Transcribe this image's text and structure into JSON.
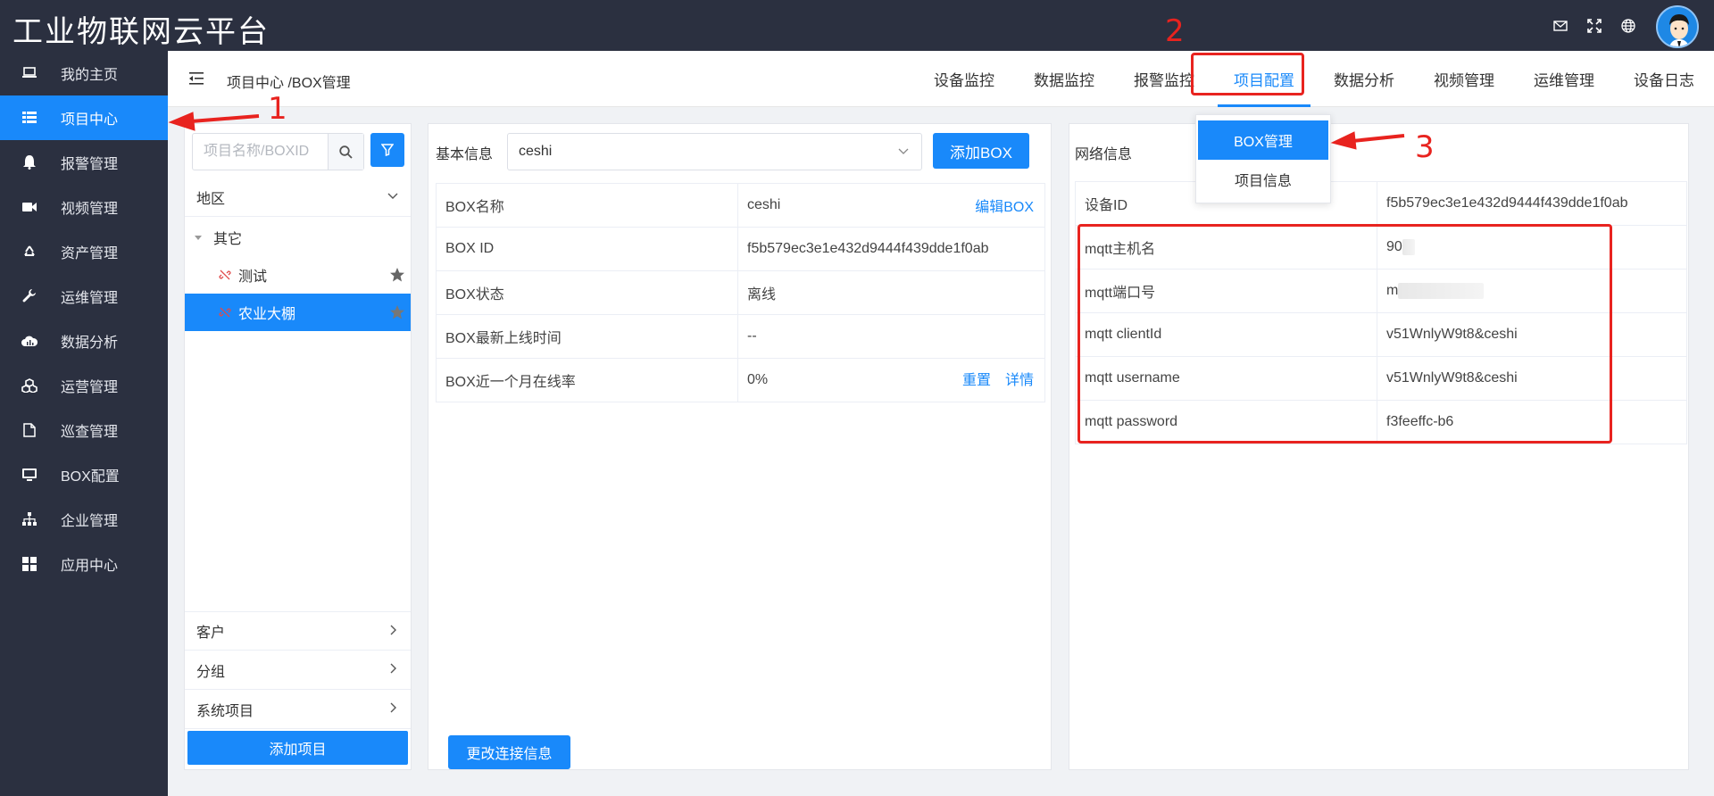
{
  "app": {
    "title": "工业物联网云平台"
  },
  "top_icons": [
    "mail-icon",
    "fullscreen-icon",
    "globe-icon"
  ],
  "sidebar": {
    "items": [
      {
        "label": "我的主页",
        "icon": "laptop-icon",
        "active": false
      },
      {
        "label": "项目中心",
        "icon": "list-icon",
        "active": true
      },
      {
        "label": "报警管理",
        "icon": "bell-icon",
        "active": false
      },
      {
        "label": "视频管理",
        "icon": "video-icon",
        "active": false
      },
      {
        "label": "资产管理",
        "icon": "recycle-icon",
        "active": false
      },
      {
        "label": "运维管理",
        "icon": "wrench-icon",
        "active": false
      },
      {
        "label": "数据分析",
        "icon": "cloud-chart-icon",
        "active": false
      },
      {
        "label": "运营管理",
        "icon": "cubes-icon",
        "active": false
      },
      {
        "label": "巡查管理",
        "icon": "document-icon",
        "active": false
      },
      {
        "label": "BOX配置",
        "icon": "monitor-icon",
        "active": false
      },
      {
        "label": "企业管理",
        "icon": "org-chart-icon",
        "active": false
      },
      {
        "label": "应用中心",
        "icon": "grid-icon",
        "active": false
      }
    ]
  },
  "header": {
    "breadcrumb": "项目中心 /BOX管理",
    "tabs": [
      {
        "label": "设备监控",
        "active": false
      },
      {
        "label": "数据监控",
        "active": false
      },
      {
        "label": "报警监控",
        "active": false
      },
      {
        "label": "项目配置",
        "active": true
      },
      {
        "label": "数据分析",
        "active": false
      },
      {
        "label": "视频管理",
        "active": false
      },
      {
        "label": "运维管理",
        "active": false
      },
      {
        "label": "设备日志",
        "active": false
      }
    ]
  },
  "dropdown": {
    "items": [
      {
        "label": "BOX管理",
        "active": true
      },
      {
        "label": "项目信息",
        "active": false
      }
    ]
  },
  "left_panel": {
    "search_placeholder": "项目名称/BOXID",
    "region_label": "地区",
    "tree": {
      "group": "其它",
      "nodes": [
        {
          "label": "测试",
          "selected": false
        },
        {
          "label": "农业大棚",
          "selected": true
        }
      ]
    },
    "sections": [
      "客户",
      "分组",
      "系统项目"
    ],
    "add_button": "添加项目"
  },
  "basic_info": {
    "label": "基本信息",
    "selected_box": "ceshi",
    "add_box_button": "添加BOX",
    "rows": [
      {
        "key": "BOX名称",
        "value": "ceshi",
        "action": "编辑BOX"
      },
      {
        "key": "BOX ID",
        "value": "f5b579ec3e1e432d9444f439dde1f0ab"
      },
      {
        "key": "BOX状态",
        "value": "离线"
      },
      {
        "key": "BOX最新上线时间",
        "value": "--"
      },
      {
        "key": "BOX近一个月在线率",
        "value": "0%",
        "action_reset": "重置",
        "action_detail": "详情"
      }
    ],
    "change_button": "更改连接信息"
  },
  "network_info": {
    "label": "网络信息",
    "rows": [
      {
        "key": "设备ID",
        "value": "f5b579ec3e1e432d9444f439dde1f0ab"
      },
      {
        "key": "mqtt主机名",
        "value": "90"
      },
      {
        "key": "mqtt端口号",
        "value": "m"
      },
      {
        "key": "mqtt clientId",
        "value": "v51WnlyW9t8&ceshi"
      },
      {
        "key": "mqtt username",
        "value": "v51WnlyW9t8&ceshi"
      },
      {
        "key": "mqtt password",
        "value": "f3feeffc-b6"
      }
    ]
  },
  "annotations": {
    "n1": "1",
    "n2": "2",
    "n3": "3",
    "color": "#e8231f"
  },
  "colors": {
    "accent": "#1989fa",
    "sidebar": "#2b3040",
    "offline": "#f01818"
  }
}
